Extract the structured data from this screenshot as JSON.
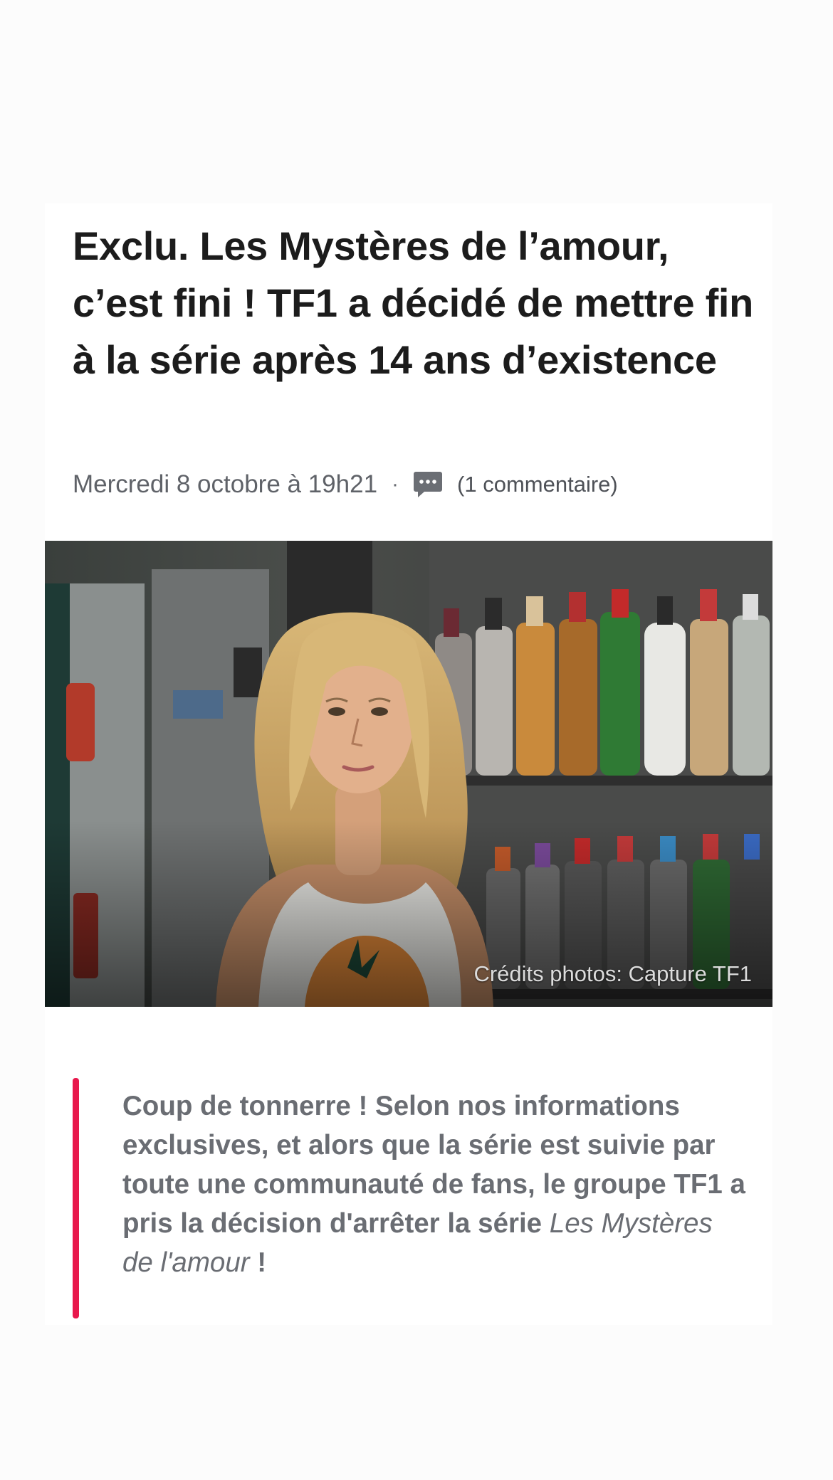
{
  "article": {
    "title": "Exclu. Les Mystères de l’amour, c’est fini ! TF1 a décidé de mettre fin à la série après 14 ans d’existence",
    "date": "Mercredi 8 octobre à 19h21",
    "separator": "·",
    "comments": "(1 commentaire)",
    "comment_icon": "speech-bubble-icon",
    "photo_credit": "Crédits photos: Capture TF1",
    "lead": {
      "text": "Coup de tonnerre ! Selon nos informations exclusives, et alors que la série est suivie par toute une communauté de fans, le groupe TF1 a pris la décision d'arrêter la série ",
      "italic": "Les Mystères de l'amour",
      "end": " !"
    }
  },
  "colors": {
    "accent": "#e8184c",
    "title": "#1c1c1c",
    "meta": "#5f6268",
    "lead": "#6a6d73"
  }
}
